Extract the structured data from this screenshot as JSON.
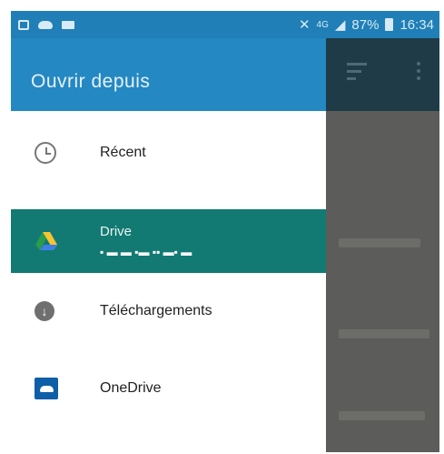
{
  "status_bar": {
    "network_label": "4G",
    "battery_percent": "87%",
    "time": "16:34"
  },
  "drawer": {
    "title": "Ouvrir depuis",
    "items": [
      {
        "label": "Récent",
        "icon": "clock-icon"
      },
      {
        "label": "Drive",
        "icon": "google-drive-icon",
        "sublabel": "▪ ▬  ▬ ▪▬ ▪▪ ▬▪  ▬"
      },
      {
        "label": "Téléchargements",
        "icon": "download-icon"
      },
      {
        "label": "OneDrive",
        "icon": "onedrive-icon"
      }
    ],
    "selected_index": 1
  },
  "colors": {
    "status_bar": "#1f7fb6",
    "drawer_header": "#2488c3",
    "selected_item": "#127a73",
    "scrim": "#5c5c5a",
    "app_toolbar": "#1e3b47"
  }
}
